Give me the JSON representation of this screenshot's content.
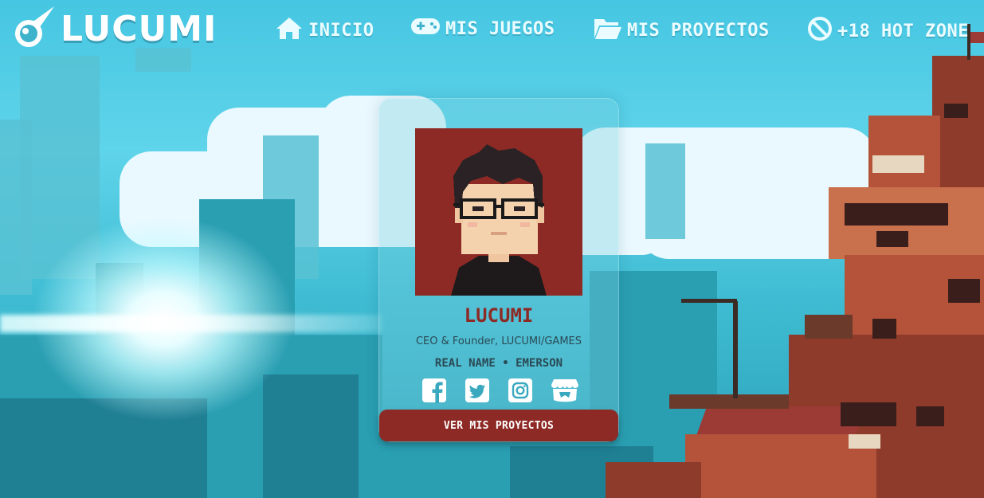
{
  "brand": {
    "name": "LUCUMI",
    "logo_icon": "meteor-icon"
  },
  "nav": {
    "items": [
      {
        "label": "INICIO",
        "icon": "home-icon"
      },
      {
        "label": "MIS JUEGOS",
        "icon": "gamepad-icon"
      },
      {
        "label": "MIS PROYECTOS",
        "icon": "folder-icon"
      },
      {
        "label": "+18 HOT ZONE",
        "icon": "ban-icon"
      }
    ]
  },
  "profile": {
    "name": "LUCUMI",
    "role": "CEO & Founder, LUCUMI/GAMES",
    "real_name": "REAL NAME • EMERSON",
    "socials": [
      {
        "name": "facebook",
        "icon": "facebook-icon"
      },
      {
        "name": "twitter",
        "icon": "twitter-icon"
      },
      {
        "name": "instagram",
        "icon": "instagram-icon"
      },
      {
        "name": "itch.io",
        "icon": "itchio-icon"
      }
    ],
    "cta_label": "VER MIS PROYECTOS"
  },
  "colors": {
    "accent": "#8d2a25",
    "sky": "#46c6e2",
    "nav_text": "#eafcff"
  }
}
